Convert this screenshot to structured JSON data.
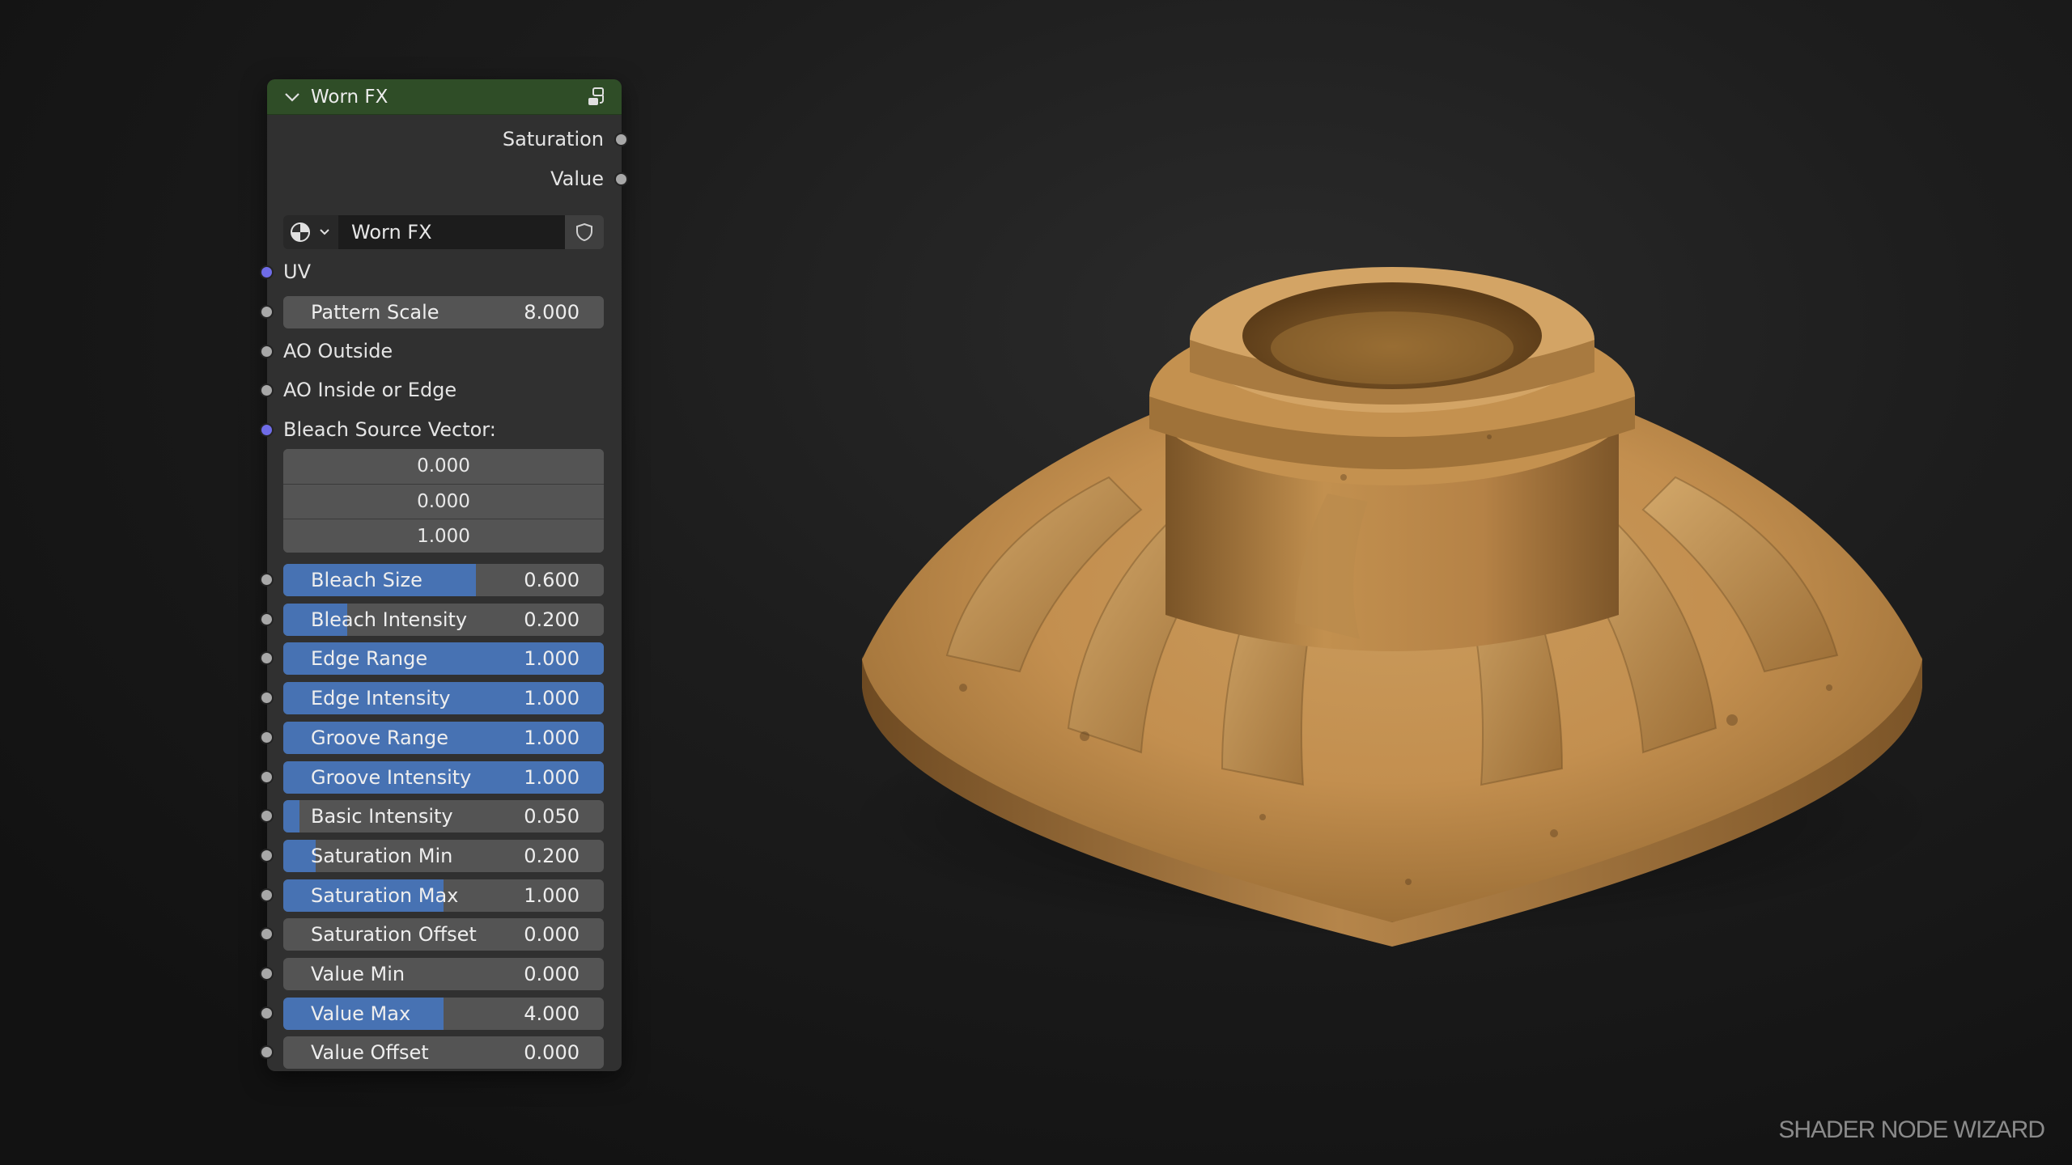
{
  "node": {
    "title": "Worn FX",
    "header_color": "#2f4d27",
    "icons": {
      "collapse": "chevron-down-icon",
      "node_group": "node-group-icon"
    },
    "outputs": [
      "Saturation",
      "Value"
    ],
    "group_selector": {
      "type_icon": "shader-sphere-icon",
      "name": "Worn FX",
      "fake_user_icon": "shield-icon"
    },
    "inputs": {
      "uv": "UV",
      "pattern_scale": {
        "label": "Pattern Scale",
        "value": "8.000"
      },
      "ao_outside": "AO Outside",
      "ao_inside": "AO Inside or Edge",
      "bleach_vector": {
        "label": "Bleach Source Vector:",
        "x": "0.000",
        "y": "0.000",
        "z": "1.000"
      }
    },
    "sliders": [
      {
        "label": "Bleach Size",
        "value": "0.600",
        "fill": 0.6
      },
      {
        "label": "Bleach Intensity",
        "value": "0.200",
        "fill": 0.2
      },
      {
        "label": "Edge Range",
        "value": "1.000",
        "fill": 1.0
      },
      {
        "label": "Edge Intensity",
        "value": "1.000",
        "fill": 1.0
      },
      {
        "label": "Groove Range",
        "value": "1.000",
        "fill": 1.0
      },
      {
        "label": "Groove Intensity",
        "value": "1.000",
        "fill": 1.0
      },
      {
        "label": "Basic Intensity",
        "value": "0.050",
        "fill": 0.05
      },
      {
        "label": "Saturation Min",
        "value": "0.200",
        "fill": 0.1
      },
      {
        "label": "Saturation Max",
        "value": "1.000",
        "fill": 0.5
      },
      {
        "label": "Saturation Offset",
        "value": "0.000",
        "fill": 0
      },
      {
        "label": "Value Min",
        "value": "0.000",
        "fill": 0
      },
      {
        "label": "Value Max",
        "value": "4.000",
        "fill": 0.5
      },
      {
        "label": "Value Offset",
        "value": "0.000",
        "fill": 0
      }
    ],
    "colors": {
      "slider_fill": "#4772b3",
      "vector_socket": "#6f6ce8",
      "value_socket": "#a8a8a8"
    }
  },
  "watermark": "SHADER NODE WIZARD"
}
